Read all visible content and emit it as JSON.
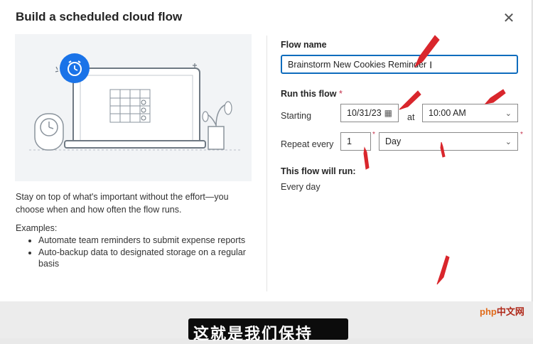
{
  "dialog": {
    "title": "Build a scheduled cloud flow",
    "close_icon": "close-icon"
  },
  "left": {
    "description": "Stay on top of what's important without the effort—you choose when and how often the flow runs.",
    "examples_label": "Examples:",
    "examples": [
      "Automate team reminders to submit expense reports",
      "Auto-backup data to designated storage on a regular basis"
    ]
  },
  "form": {
    "flow_name_label": "Flow name",
    "flow_name_value": "Brainstorm New Cookies Reminder",
    "run_label": "Run this flow",
    "required_mark": "*",
    "starting_label": "Starting",
    "start_date": "10/31/23",
    "at_label": "at",
    "start_time": "10:00 AM",
    "repeat_label": "Repeat every",
    "repeat_value": "1",
    "repeat_unit": "Day",
    "will_run_label": "This flow will run:",
    "will_run_value": "Every day"
  },
  "overlay": {
    "subtitle": "这就是我们保持",
    "watermark": "php",
    "watermark_cn": "中文网"
  },
  "colors": {
    "accent": "#0f6cbd",
    "annotation": "#d9262c",
    "required": "#c4314b"
  }
}
